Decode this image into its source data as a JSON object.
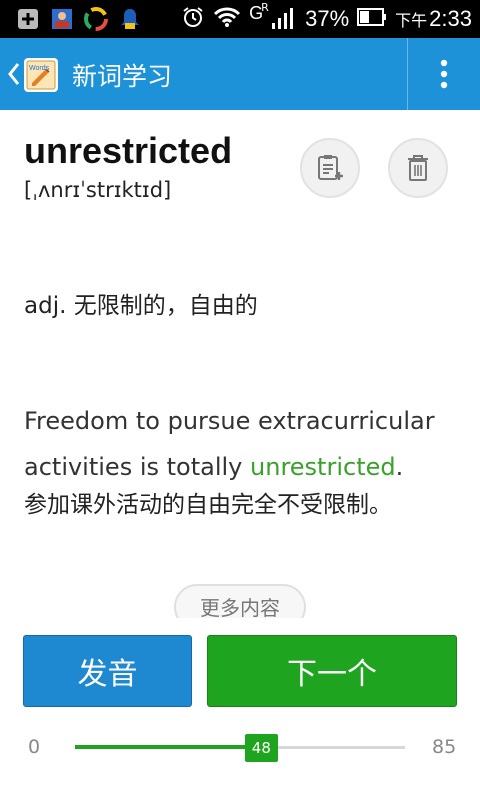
{
  "status_bar": {
    "battery_percent": "37%",
    "network": "G",
    "network_sup": "R",
    "time_prefix": "下午",
    "time": "2:33",
    "icons": [
      "add-box-icon",
      "photo-icon",
      "app-circle-icon",
      "notification-icon",
      "alarm-icon",
      "wifi-icon",
      "signal-icon",
      "battery-icon"
    ]
  },
  "appbar": {
    "title": "新词学习",
    "logo_text": "Words"
  },
  "word": {
    "text": "unrestricted",
    "phonetic": "[ˌʌnrɪˈstrɪktɪd]"
  },
  "definition": "adj. 无限制的，自由的",
  "example": {
    "before": "Freedom to pursue extracurricular activities is totally ",
    "highlight": "unrestricted",
    "after": ".",
    "translation": "参加课外活动的自由完全不受限制。"
  },
  "more_button": "更多内容",
  "buttons": {
    "pronounce": "发音",
    "next": "下一个"
  },
  "progress": {
    "min": "0",
    "max": "85",
    "current": "48",
    "current_value": 48,
    "max_value": 85
  },
  "colors": {
    "appbar": "#1d92d8",
    "primary_blue": "#1e88d0",
    "primary_green": "#1fa41f",
    "highlight_green": "#3aa12a"
  }
}
